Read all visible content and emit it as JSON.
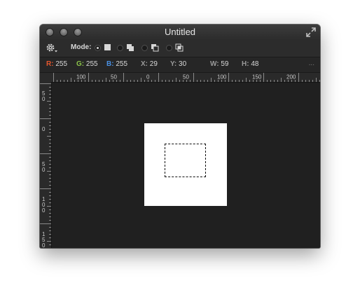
{
  "window": {
    "title": "Untitled"
  },
  "toolbar": {
    "mode_label": "Mode:",
    "modes": [
      {
        "name": "normal",
        "selected": true
      },
      {
        "name": "add",
        "selected": false
      },
      {
        "name": "subtract",
        "selected": false
      },
      {
        "name": "intersect",
        "selected": false
      }
    ]
  },
  "info": {
    "r_label": "R:",
    "r": "255",
    "g_label": "G:",
    "g": "255",
    "b_label": "B:",
    "b": "255",
    "x_label": "X:",
    "x": "29",
    "y_label": "Y:",
    "y": "30",
    "w_label": "W:",
    "w": "59",
    "h_label": "H:",
    "h": "48",
    "more": "..."
  },
  "colors": {
    "r": "#e4572e",
    "g": "#8bc34a",
    "b": "#4a90e2",
    "label": "#9a9a9a"
  },
  "hruler_labels": [
    "100",
    "50",
    "0",
    "50",
    "100",
    "150",
    "200"
  ],
  "vruler_labels": [
    "5\n0",
    "0",
    "5\n0",
    "1\n0\n0",
    "1\n5\n0"
  ]
}
